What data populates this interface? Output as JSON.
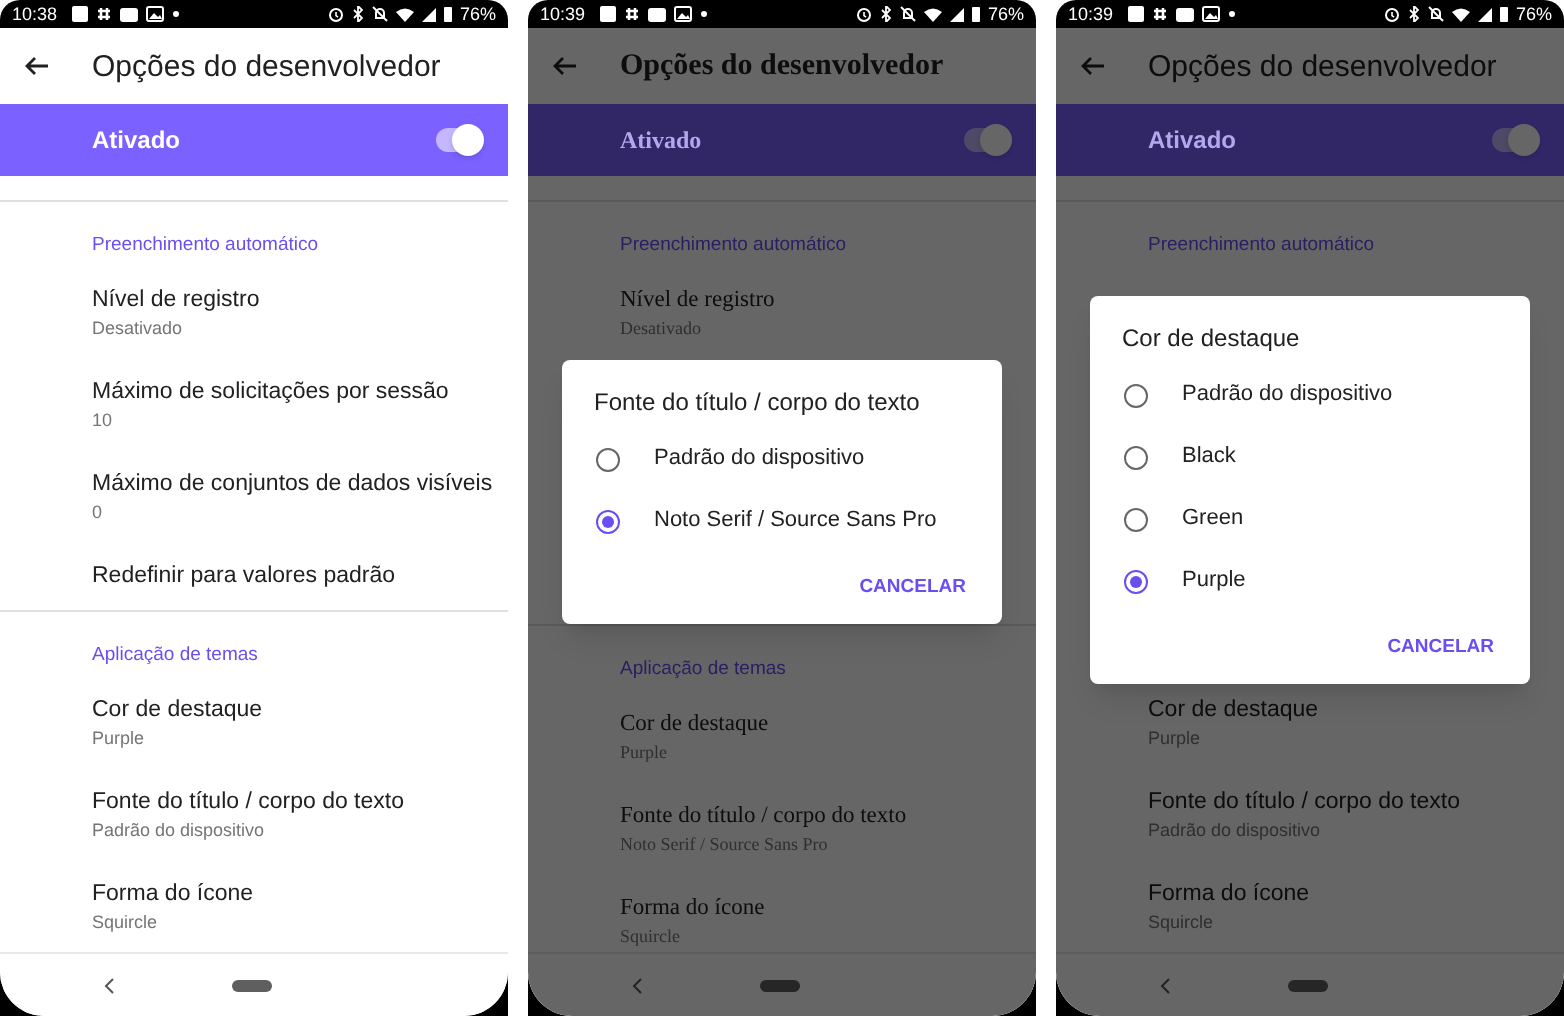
{
  "screens": [
    {
      "status_bar": {
        "time": "10:38",
        "battery": "76%"
      },
      "app_bar": {
        "title": "Opções do desenvolvedor"
      },
      "kind": "sans",
      "dimmed": false,
      "master_switch": {
        "label": "Ativado",
        "on": true
      },
      "entries": [
        {
          "kind": "header",
          "text": "Preenchimento automático"
        },
        {
          "kind": "item",
          "title": "Nível de registro",
          "subtitle": "Desativado"
        },
        {
          "kind": "item",
          "title": "Máximo de solicitações por sessão",
          "subtitle": "10"
        },
        {
          "kind": "item",
          "title": "Máximo de conjuntos de dados visíveis",
          "subtitle": "0"
        },
        {
          "kind": "item",
          "title": "Redefinir para valores padrão"
        },
        {
          "kind": "header",
          "text": "Aplicação de temas"
        },
        {
          "kind": "item",
          "title": "Cor de destaque",
          "subtitle": "Purple"
        },
        {
          "kind": "item",
          "title": "Fonte do título / corpo do texto",
          "subtitle": "Padrão do dispositivo"
        },
        {
          "kind": "item",
          "title": "Forma do ícone",
          "subtitle": "Squircle"
        }
      ]
    },
    {
      "status_bar": {
        "time": "10:39",
        "battery": "76%"
      },
      "app_bar": {
        "title": "Opções do desenvolvedor"
      },
      "kind": "serif",
      "dimmed": true,
      "master_switch": {
        "label": "Ativado",
        "on": true
      },
      "entries": [
        {
          "kind": "header",
          "text": "Preenchimento automático"
        },
        {
          "kind": "item",
          "title": "Nível de registro",
          "subtitle": "Desativado"
        },
        {
          "kind": "dialog",
          "title": "Fonte do título / corpo do texto",
          "options": [
            {
              "label": "Padrão do dispositivo",
              "selected": false
            },
            {
              "label": "Noto Serif / Source Sans Pro",
              "selected": true
            }
          ],
          "button": "CANCELAR"
        },
        {
          "kind": "header",
          "text": "Aplicação de temas"
        },
        {
          "kind": "item",
          "title": "Cor de destaque",
          "subtitle": "Purple"
        },
        {
          "kind": "item",
          "title": "Fonte do título / corpo do texto",
          "subtitle": "Noto Serif / Source Sans Pro"
        },
        {
          "kind": "item",
          "title": "Forma do ícone",
          "subtitle": "Squircle"
        }
      ]
    },
    {
      "status_bar": {
        "time": "10:39",
        "battery": "76%"
      },
      "app_bar": {
        "title": "Opções do desenvolvedor"
      },
      "kind": "sans",
      "dimmed": true,
      "master_switch": {
        "label": "Ativado",
        "on": true
      },
      "entries": [
        {
          "kind": "header",
          "text": "Preenchimento automático"
        },
        {
          "kind": "dialog",
          "title": "Cor de destaque",
          "options": [
            {
              "label": "Padrão do dispositivo",
              "selected": false
            },
            {
              "label": "Black",
              "selected": false
            },
            {
              "label": "Green",
              "selected": false
            },
            {
              "label": "Purple",
              "selected": true
            }
          ],
          "button": "CANCELAR"
        },
        {
          "kind": "item",
          "title": "Cor de destaque",
          "subtitle": "Purple"
        },
        {
          "kind": "item",
          "title": "Fonte do título / corpo do texto",
          "subtitle": "Padrão do dispositivo"
        },
        {
          "kind": "item",
          "title": "Forma do ícone",
          "subtitle": "Squircle"
        }
      ]
    }
  ]
}
